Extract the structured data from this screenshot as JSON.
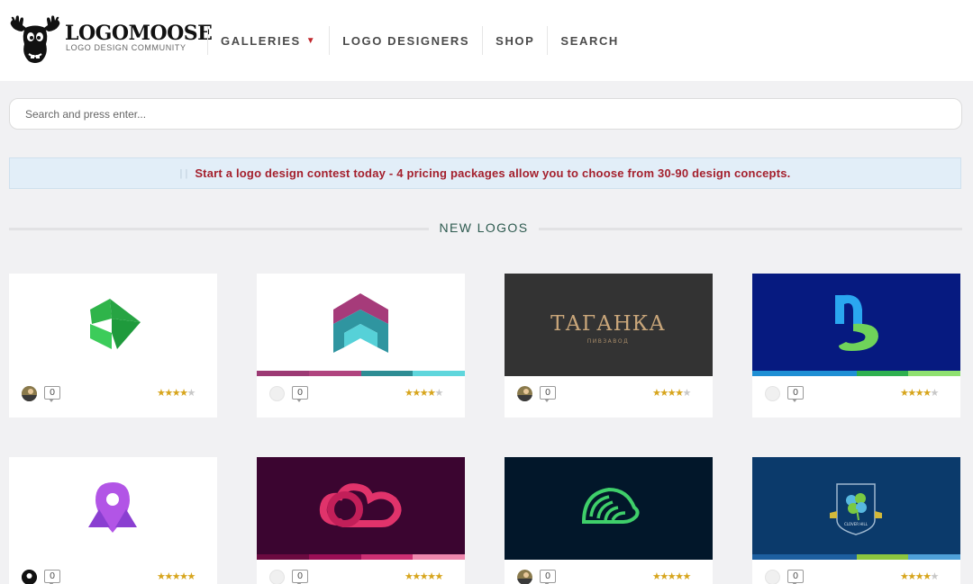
{
  "header": {
    "logo": {
      "title": "LOGOMOOSE",
      "subtitle": "LOGO DESIGN COMMUNITY"
    },
    "nav": [
      {
        "label": "GALLERIES",
        "has_caret": true,
        "caret": "▼"
      },
      {
        "label": "LOGO DESIGNERS"
      },
      {
        "label": "SHOP"
      },
      {
        "label": "SEARCH"
      }
    ]
  },
  "search": {
    "placeholder": "Search and press enter...",
    "value": ""
  },
  "banner": {
    "text": "Start a logo design contest today - 4 pricing packages allow you to choose from 30-90 design concepts."
  },
  "section": {
    "title": "NEW LOGOS"
  },
  "logos": [
    {
      "bg": "#ffffff",
      "avatar": "photo",
      "comments": "0",
      "rating": 4,
      "wordmark": ""
    },
    {
      "bg": "#ffffff",
      "avatar": "default",
      "comments": "0",
      "rating": 4,
      "wordmark": "",
      "stripe": [
        "#9c3a74",
        "#b0447f",
        "#2e8d94",
        "#5fd6dc"
      ]
    },
    {
      "bg": "#333333",
      "avatar": "photo",
      "comments": "0",
      "rating": 4,
      "wordmark": "ТАГАНКА",
      "wordmark_sub": "ПИВЗАВОД"
    },
    {
      "bg": "#061a80",
      "avatar": "default",
      "comments": "0",
      "rating": 4,
      "wordmark": "",
      "stripe": [
        "#1f8fd4",
        "#1f8fd4",
        "#2fb04f",
        "#8fe070"
      ]
    },
    {
      "bg": "#ffffff",
      "avatar": "photo",
      "comments": "0",
      "rating": 5,
      "wordmark": ""
    },
    {
      "bg": "#3b0530",
      "avatar": "default",
      "comments": "0",
      "rating": 5,
      "wordmark": "",
      "stripe": [
        "#6b0a40",
        "#9a0e55",
        "#cc2f73",
        "#ee87ad"
      ]
    },
    {
      "bg": "#02172a",
      "avatar": "photo",
      "comments": "0",
      "rating": 5,
      "wordmark": ""
    },
    {
      "bg": "#0b3a6b",
      "avatar": "default",
      "comments": "0",
      "rating": 4,
      "wordmark": "CLOVER HILL",
      "stripe": [
        "#1d5fa0",
        "#1d5fa0",
        "#8cc63f",
        "#4fa0d8"
      ]
    }
  ],
  "colors": {
    "accent": "#a4202d",
    "section_title": "#2d5a4f",
    "star": "#d7a51d"
  },
  "icons": {
    "caret": "chevron-down-icon",
    "comments": "comment-bubble-icon",
    "rating": "star-icon"
  }
}
